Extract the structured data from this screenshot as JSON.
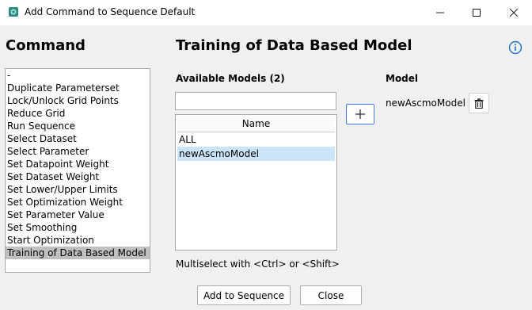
{
  "window": {
    "title": "Add Command to Sequence Default",
    "controls": [
      "minimize-icon",
      "maximize-icon",
      "close-icon"
    ]
  },
  "command_panel": {
    "heading": "Command",
    "items": [
      "-",
      "Duplicate Parameterset",
      "Lock/Unlock Grid Points",
      "Reduce Grid",
      "Run Sequence",
      "Select Dataset",
      "Select Parameter",
      "Set Datapoint Weight",
      "Set Dataset Weight",
      "Set Lower/Upper Limits",
      "Set Optimization Weight",
      "Set Parameter Value",
      "Set Smoothing",
      "Start Optimization",
      "Training of Data Based Model"
    ],
    "selected": "Training of Data Based Model"
  },
  "main": {
    "heading": "Training of Data Based Model",
    "available_label": "Available Models (2)",
    "search_value": "",
    "table": {
      "column": "Name",
      "rows": [
        "ALL",
        "newAscmoModel"
      ],
      "selected": "newAscmoModel"
    },
    "hint": "Multiselect with <Ctrl> or <Shift>",
    "model_label": "Model",
    "model_value": "newAscmoModel"
  },
  "footer": {
    "add_label": "Add to Sequence",
    "close_label": "Close"
  },
  "colors": {
    "accent": "#3c7bd6",
    "list_selection": "#c0c0c0",
    "table_selection": "#cce4f7",
    "info": "#1a73c8"
  }
}
